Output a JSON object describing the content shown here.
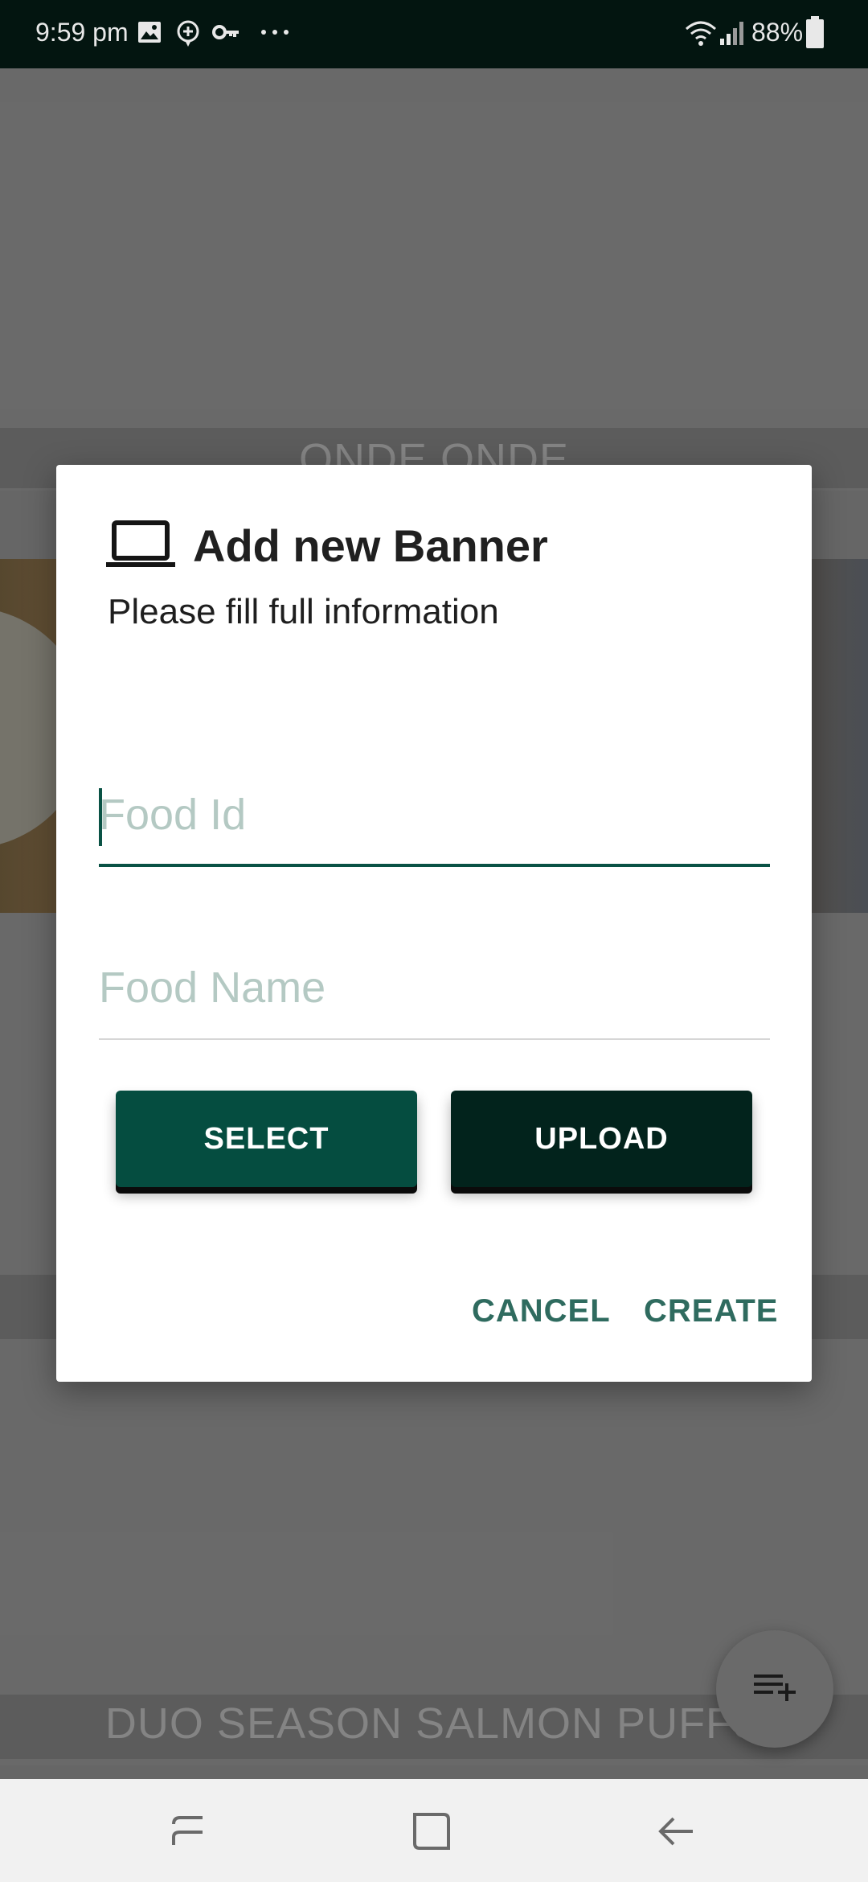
{
  "status_bar": {
    "time": "9:59 pm",
    "battery": "88%",
    "icons": [
      "gallery-icon",
      "location-icon",
      "key-icon",
      "more-dots-icon",
      "wifi-icon",
      "signal-icon",
      "battery-icon"
    ]
  },
  "background_cards": [
    {
      "label": "ONDE ONDE"
    },
    {
      "label": "DUO SEASON SALMON PUFFS"
    }
  ],
  "dialog": {
    "icon": "laptop-icon",
    "title": "Add new Banner",
    "subtitle": "Please fill full information",
    "food_id": {
      "value": "",
      "placeholder": "Food Id"
    },
    "food_name": {
      "value": "",
      "placeholder": "Food Name"
    },
    "select_label": "SELECT",
    "upload_label": "UPLOAD",
    "cancel_label": "CANCEL",
    "create_label": "CREATE"
  },
  "fab": {
    "icon": "playlist-add-icon"
  },
  "nav_bar": {
    "icons": [
      "recent-apps-icon",
      "home-icon",
      "back-icon"
    ]
  },
  "colors": {
    "primary": "#054d40",
    "primary_dark": "#02231c",
    "accent_text": "#2f6b5f",
    "hint": "#b4c9c3"
  }
}
